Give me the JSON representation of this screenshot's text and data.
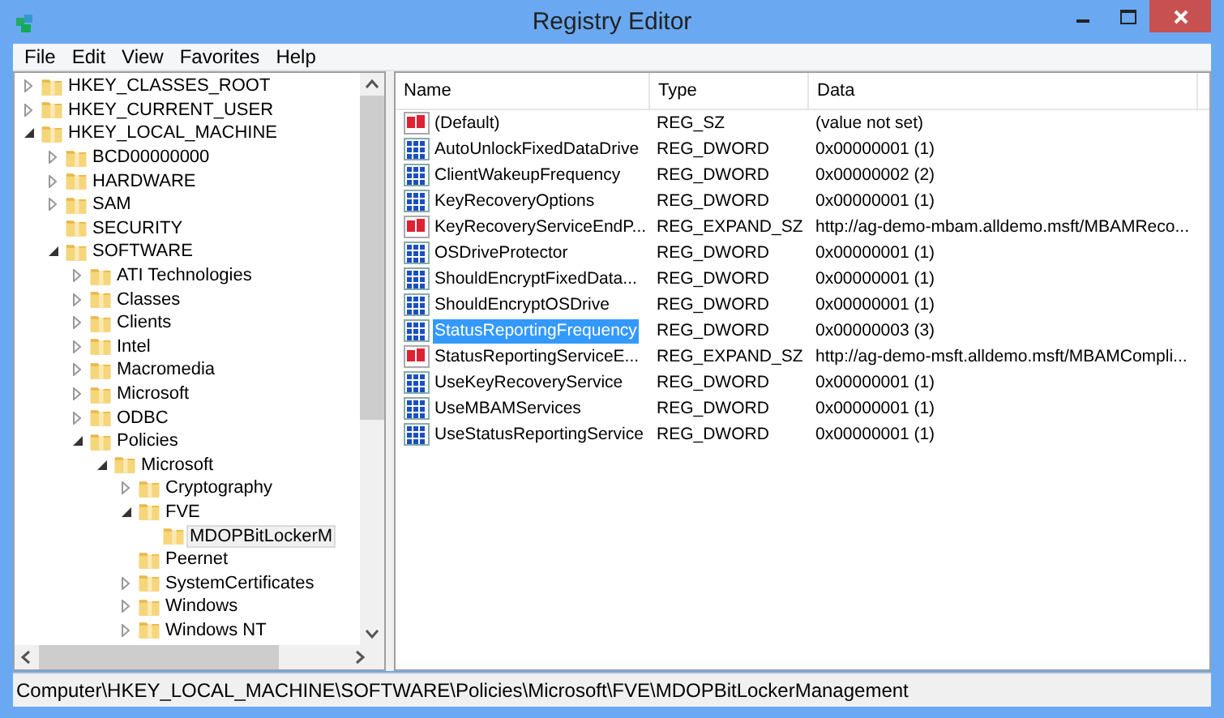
{
  "window": {
    "title": "Registry Editor"
  },
  "menu": [
    "File",
    "Edit",
    "View",
    "Favorites",
    "Help"
  ],
  "tree": [
    {
      "label": "HKEY_CLASSES_ROOT",
      "expanded": false,
      "selected": false
    },
    {
      "label": "HKEY_CURRENT_USER",
      "expanded": false,
      "selected": false
    },
    {
      "label": "HKEY_LOCAL_MACHINE",
      "expanded": true,
      "selected": false,
      "children": [
        {
          "label": "BCD00000000",
          "expanded": false,
          "selected": false
        },
        {
          "label": "HARDWARE",
          "expanded": false,
          "selected": false
        },
        {
          "label": "SAM",
          "expanded": false,
          "selected": false
        },
        {
          "label": "SECURITY",
          "selected": false
        },
        {
          "label": "SOFTWARE",
          "expanded": true,
          "selected": false,
          "children": [
            {
              "label": "ATI Technologies",
              "expanded": false,
              "selected": false
            },
            {
              "label": "Classes",
              "expanded": false,
              "selected": false
            },
            {
              "label": "Clients",
              "expanded": false,
              "selected": false
            },
            {
              "label": "Intel",
              "expanded": false,
              "selected": false
            },
            {
              "label": "Macromedia",
              "expanded": false,
              "selected": false
            },
            {
              "label": "Microsoft",
              "expanded": false,
              "selected": false
            },
            {
              "label": "ODBC",
              "expanded": false,
              "selected": false
            },
            {
              "label": "Policies",
              "expanded": true,
              "selected": false,
              "children": [
                {
                  "label": "Microsoft",
                  "expanded": true,
                  "selected": false,
                  "children": [
                    {
                      "label": "Cryptography",
                      "expanded": false,
                      "selected": false
                    },
                    {
                      "label": "FVE",
                      "expanded": true,
                      "selected": false,
                      "children": [
                        {
                          "label": "MDOPBitLockerM",
                          "selected": true
                        }
                      ]
                    },
                    {
                      "label": "Peernet",
                      "selected": false
                    },
                    {
                      "label": "SystemCertificates",
                      "expanded": false,
                      "selected": false
                    },
                    {
                      "label": "Windows",
                      "expanded": false,
                      "selected": false
                    },
                    {
                      "label": "Windows NT",
                      "expanded": false,
                      "selected": false
                    }
                  ]
                }
              ]
            }
          ]
        }
      ]
    }
  ],
  "columns": [
    "Name",
    "Type",
    "Data"
  ],
  "values": [
    {
      "kind": "string",
      "name": "(Default)",
      "type": "REG_SZ",
      "data": "(value not set)",
      "selected": false
    },
    {
      "kind": "dword",
      "name": "AutoUnlockFixedDataDrive",
      "type": "REG_DWORD",
      "data": "0x00000001 (1)",
      "selected": false
    },
    {
      "kind": "dword",
      "name": "ClientWakeupFrequency",
      "type": "REG_DWORD",
      "data": "0x00000002 (2)",
      "selected": false
    },
    {
      "kind": "dword",
      "name": "KeyRecoveryOptions",
      "type": "REG_DWORD",
      "data": "0x00000001 (1)",
      "selected": false
    },
    {
      "kind": "string",
      "name": "KeyRecoveryServiceEndP...",
      "type": "REG_EXPAND_SZ",
      "data": "http://ag-demo-mbam.alldemo.msft/MBAMReco...",
      "selected": false
    },
    {
      "kind": "dword",
      "name": "OSDriveProtector",
      "type": "REG_DWORD",
      "data": "0x00000001 (1)",
      "selected": false
    },
    {
      "kind": "dword",
      "name": "ShouldEncryptFixedData...",
      "type": "REG_DWORD",
      "data": "0x00000001 (1)",
      "selected": false
    },
    {
      "kind": "dword",
      "name": "ShouldEncryptOSDrive",
      "type": "REG_DWORD",
      "data": "0x00000001 (1)",
      "selected": false
    },
    {
      "kind": "dword",
      "name": "StatusReportingFrequency",
      "type": "REG_DWORD",
      "data": "0x00000003 (3)",
      "selected": true
    },
    {
      "kind": "string",
      "name": "StatusReportingServiceE...",
      "type": "REG_EXPAND_SZ",
      "data": "http://ag-demo-msft.alldemo.msft/MBAMCompli...",
      "selected": false
    },
    {
      "kind": "dword",
      "name": "UseKeyRecoveryService",
      "type": "REG_DWORD",
      "data": "0x00000001 (1)",
      "selected": false
    },
    {
      "kind": "dword",
      "name": "UseMBAMServices",
      "type": "REG_DWORD",
      "data": "0x00000001 (1)",
      "selected": false
    },
    {
      "kind": "dword",
      "name": "UseStatusReportingService",
      "type": "REG_DWORD",
      "data": "0x00000001 (1)",
      "selected": false
    }
  ],
  "status_bar": "Computer\\HKEY_LOCAL_MACHINE\\SOFTWARE\\Policies\\Microsoft\\FVE\\MDOPBitLockerManagement"
}
